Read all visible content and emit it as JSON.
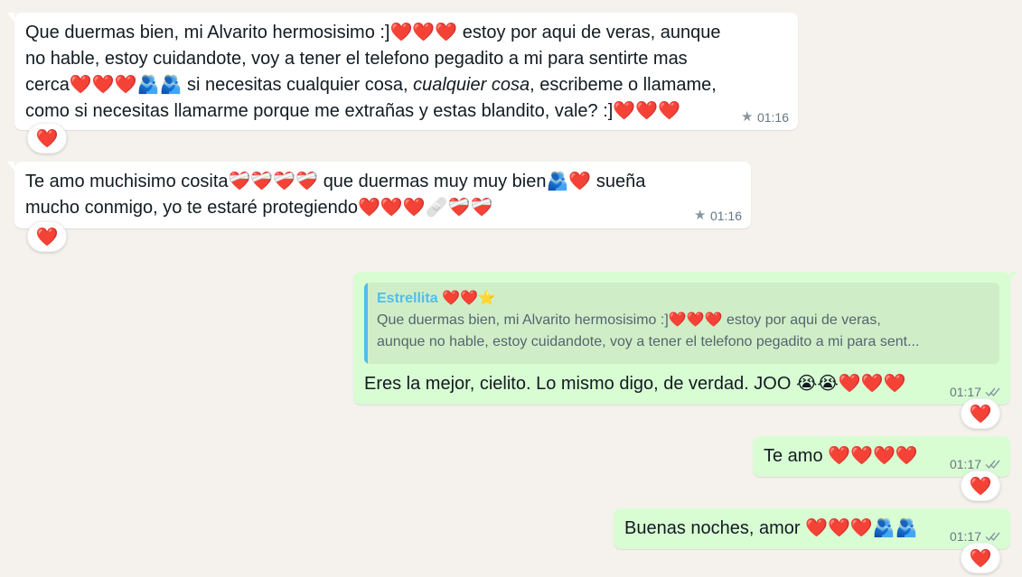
{
  "messages": [
    {
      "id": "m1",
      "direction": "incoming",
      "text_before_italic": "Que duermas bien, mi Alvarito hermosisimo :]❤️❤️❤️ estoy por aqui de veras, aunque no hable, estoy cuidandote, voy a tener el telefono pegadito a mi para sentirte mas cerca❤️❤️❤️🫂🫂 si necesitas cualquier cosa, ",
      "italic": "cualquier cosa",
      "text_after_italic": ", escribeme o llamame, como si necesitas llamarme porque me extrañas y estas blandito, vale? :]❤️❤️❤️",
      "time": "01:16",
      "starred": true,
      "reaction": "❤️"
    },
    {
      "id": "m2",
      "direction": "incoming",
      "text": "Te amo muchisimo cosita❤️‍🩹❤️‍🩹❤️‍🩹❤️‍🩹 que duermas muy muy bien🫂❤️ sueña mucho conmigo, yo te estaré protegiendo❤️❤️❤️🩹❤️‍🩹❤️‍🩹",
      "time": "01:16",
      "starred": true,
      "reaction": "❤️"
    },
    {
      "id": "m3",
      "direction": "outgoing",
      "quote_author": "Estrellita ❤️❤️⭐",
      "quote_line1": "Que duermas bien, mi Alvarito hermosisimo :]❤️❤️❤️ estoy por aqui de veras,",
      "quote_line2": "aunque no hable, estoy cuidandote, voy a tener el telefono pegadito a mi para sent...",
      "text": "Eres la mejor, cielito. Lo mismo digo, de verdad. JOO 😭😭❤️❤️❤️",
      "time": "01:17",
      "reaction": "❤️"
    },
    {
      "id": "m4",
      "direction": "outgoing",
      "text": "Te amo ❤️❤️❤️❤️",
      "time": "01:17",
      "reaction": "❤️"
    },
    {
      "id": "m5",
      "direction": "outgoing",
      "text": "Buenas noches, amor ❤️❤️❤️🫂🫂",
      "time": "01:17",
      "reaction": "❤️"
    }
  ],
  "icons": {
    "star": "star-icon",
    "read_ticks": "double-check-icon"
  },
  "colors": {
    "background": "#f5f2ee",
    "incoming_bubble": "#ffffff",
    "outgoing_bubble": "#d9fdd3",
    "quote_accent": "#53bdeb",
    "meta_text": "#667781"
  }
}
